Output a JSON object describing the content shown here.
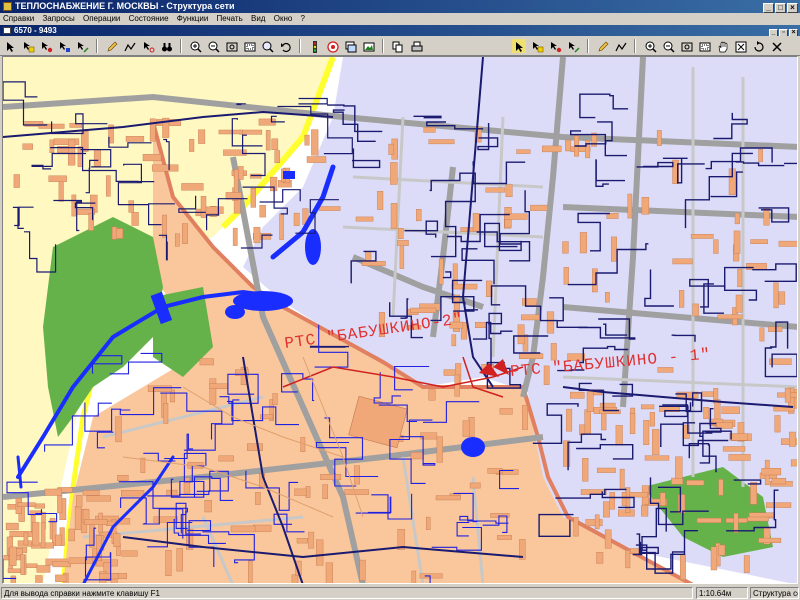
{
  "window": {
    "title": "ТЕПЛОСНАБЖЕНИЕ Г. МОСКВЫ - Структура сети"
  },
  "menu": [
    "Справки",
    "Запросы",
    "Операции",
    "Состояние",
    "Функции",
    "Печать",
    "Вид",
    "Окно",
    "?"
  ],
  "child_window": {
    "title": "6570 - 9493"
  },
  "toolbar_left": [
    "select-arrow-icon",
    "select-area-icon",
    "node-icon",
    "move-icon",
    "link-icon",
    "pencil-icon",
    "path-icon",
    "node-info-icon",
    "binoculars-icon",
    "zoom-in-icon",
    "zoom-out-icon",
    "zoom-window-icon",
    "zoom-prev-icon",
    "zoom-full-icon",
    "undo-icon",
    "traffic-light-icon",
    "target-icon",
    "layers-icon",
    "image-icon",
    "copy-icon",
    "print-icon"
  ],
  "toolbar_right": [
    "select-arrow-icon",
    "select-area-icon",
    "node-icon",
    "link-icon",
    "pencil-icon",
    "path-icon",
    "zoom-in-icon",
    "zoom-out-icon",
    "zoom-window-icon",
    "zoom-prev-icon",
    "pan-hand-icon",
    "zoom-full-icon",
    "refresh-icon",
    "close-icon"
  ],
  "map": {
    "labels": {
      "rts_babushkino_2": "РТС \"БАБУШКИНО-2\"",
      "rts_babushkino_1": "РТС \"БАБУШКИНО - 1\""
    },
    "colors": {
      "district_fill": "#f9c79b",
      "district_border": "#e08060",
      "north_fill": "#dcdcf8",
      "yellow_zone": "#fff8c0",
      "yellow_border": "#ffff30",
      "park": "#66b24a",
      "water": "#1a2dff",
      "pipe_dark": "#1a1a70",
      "pipe_blue": "#2020e0",
      "pipe_red": "#d02020",
      "road": "#a0a0a0",
      "building": "#f0a878",
      "label": "#e03030"
    }
  },
  "status": {
    "hint": "Для вывода справки нажмите клавишу F1",
    "scale": "1:10.64м",
    "mode": "Структура сети"
  }
}
